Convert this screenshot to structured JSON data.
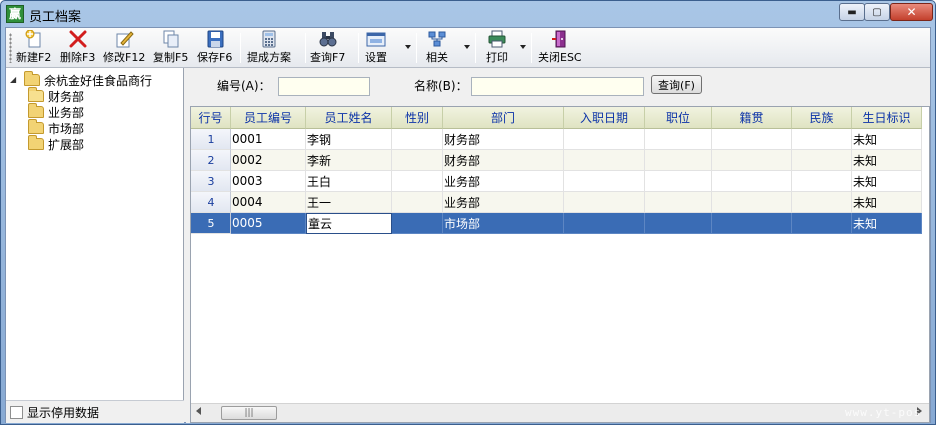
{
  "window": {
    "title": "员工档案",
    "app_icon_glyph": "赢"
  },
  "toolbar": {
    "buttons": [
      {
        "label": "新建F2",
        "icon": "new-icon"
      },
      {
        "label": "删除F3",
        "icon": "delete-icon"
      },
      {
        "label": "修改F12",
        "icon": "edit-icon"
      },
      {
        "label": "复制F5",
        "icon": "copy-icon"
      },
      {
        "label": "保存F6",
        "icon": "save-icon"
      },
      {
        "label": "提成方案",
        "icon": "calculator-icon"
      },
      {
        "label": "查询F7",
        "icon": "binoculars-icon"
      },
      {
        "label": "设置",
        "icon": "settings-window-icon"
      },
      {
        "label": "相关",
        "icon": "relation-icon"
      },
      {
        "label": "打印",
        "icon": "printer-icon"
      },
      {
        "label": "关闭ESC",
        "icon": "exit-icon"
      }
    ]
  },
  "tree": {
    "root": "余杭金好佳食品商行",
    "children": [
      "财务部",
      "业务部",
      "市场部",
      "扩展部"
    ]
  },
  "left_footer": {
    "show_disabled_label": "显示停用数据"
  },
  "search": {
    "code_label": "编号(A)：",
    "code_value": "",
    "name_label": "名称(B)：",
    "name_value": "",
    "query_button": "查询(F)"
  },
  "grid": {
    "columns": [
      "行号",
      "员工编号",
      "员工姓名",
      "性别",
      "部门",
      "入职日期",
      "职位",
      "籍贯",
      "民族",
      "生日标识"
    ],
    "rows": [
      {
        "no": "1",
        "code": "0001",
        "name": "李钢",
        "gender": "",
        "dept": "财务部",
        "hire_date": "",
        "position": "",
        "native": "",
        "ethnic": "",
        "birthday": "未知"
      },
      {
        "no": "2",
        "code": "0002",
        "name": "李新",
        "gender": "",
        "dept": "财务部",
        "hire_date": "",
        "position": "",
        "native": "",
        "ethnic": "",
        "birthday": "未知"
      },
      {
        "no": "3",
        "code": "0003",
        "name": "王白",
        "gender": "",
        "dept": "业务部",
        "hire_date": "",
        "position": "",
        "native": "",
        "ethnic": "",
        "birthday": "未知"
      },
      {
        "no": "4",
        "code": "0004",
        "name": "王一",
        "gender": "",
        "dept": "业务部",
        "hire_date": "",
        "position": "",
        "native": "",
        "ethnic": "",
        "birthday": "未知"
      },
      {
        "no": "5",
        "code": "0005",
        "name": "童云",
        "gender": "",
        "dept": "市场部",
        "hire_date": "",
        "position": "",
        "native": "",
        "ethnic": "",
        "birthday": "未知"
      }
    ],
    "selected_row": 5
  },
  "watermark": "www.yt-pos"
}
